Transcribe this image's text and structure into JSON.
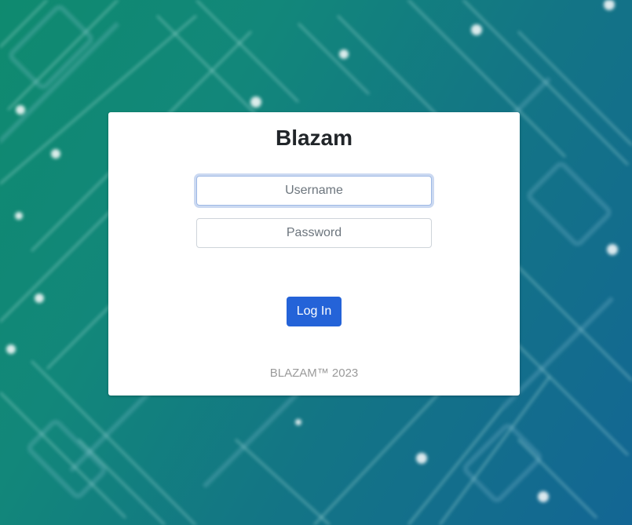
{
  "app": {
    "title": "Blazam"
  },
  "login_form": {
    "username_placeholder": "Username",
    "password_placeholder": "Password",
    "login_label": "Log In"
  },
  "footer": {
    "text": "BLAZAM™ 2023"
  },
  "colors": {
    "accent": "#2463d8",
    "background_start": "#0f8a6f",
    "background_end": "#136694"
  }
}
